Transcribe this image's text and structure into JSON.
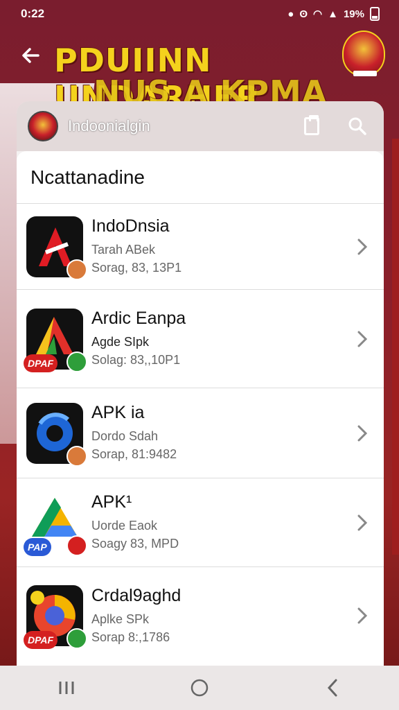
{
  "status": {
    "time": "0:22",
    "battery": "19%"
  },
  "header": {
    "banner_line1": "PDUIINN UNDARHER",
    "banner_line2": "NUS A KPMA"
  },
  "appbar": {
    "title": "Indoonialgin"
  },
  "section": {
    "title": "Ncattanadine"
  },
  "items": [
    {
      "name": "IndoDnsia",
      "line1": "Tarah ABek",
      "line2": "Sorag, 83, 13P1",
      "icon": "red-a-icon"
    },
    {
      "name": "Ardic Eanpa",
      "line1": "Agde SIpk",
      "line2": "Solag: 83,,10P1",
      "icon": "colorful-a-icon",
      "badge_text": "DPAF"
    },
    {
      "name": "APK ia",
      "line1": "Dordo Sdah",
      "line2": "Sorap, 81:9482",
      "icon": "blue-ring-icon"
    },
    {
      "name": "APK¹",
      "line1": "Uorde Eaok",
      "line2": "Soagy 83, MPD",
      "icon": "drive-triangle-icon",
      "badge_text": "PAP"
    },
    {
      "name": "Crdal9aghd",
      "line1": "Aplke SPk",
      "line2": "Sorap 8:,1786",
      "icon": "chrome-like-icon",
      "badge_text": "DPAF"
    }
  ],
  "colors": {
    "banner_yellow": "#f4d21d",
    "background_red": "#8a1f2a",
    "accent_green": "#2e9e3a"
  }
}
